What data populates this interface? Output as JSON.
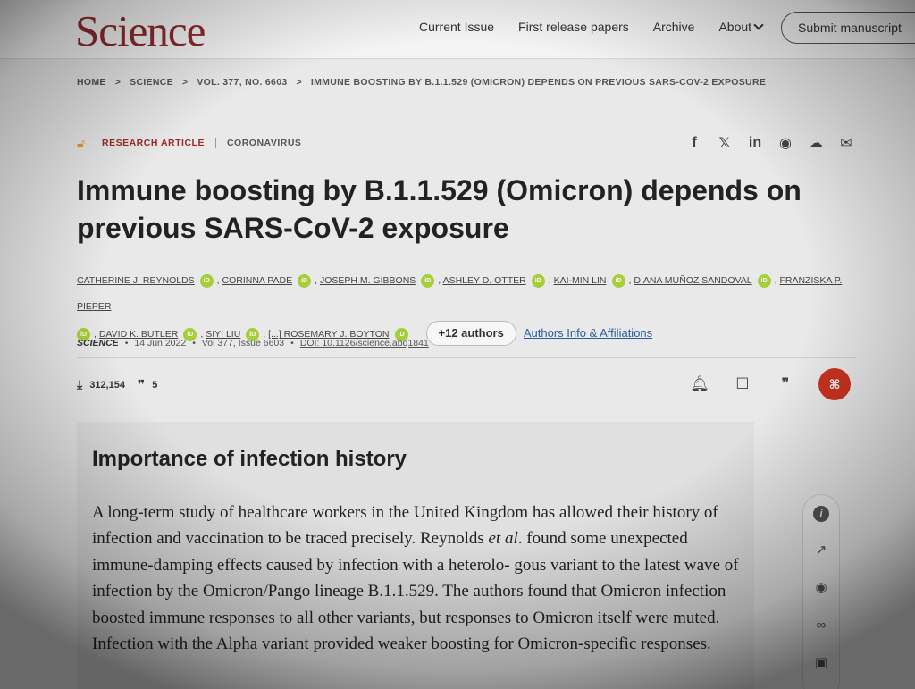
{
  "header": {
    "logo": "Science",
    "nav": [
      "Current Issue",
      "First release papers",
      "Archive",
      "About"
    ],
    "submit_label": "Submit manuscript"
  },
  "breadcrumb": [
    "HOME",
    "SCIENCE",
    "VOL. 377, NO. 6603",
    "IMMUNE BOOSTING BY B.1.1.529 (OMICRON) DEPENDS ON PREVIOUS SARS-COV-2 EXPOSURE"
  ],
  "article": {
    "type": "RESEARCH ARTICLE",
    "subject": "CORONAVIRUS",
    "title": "Immune boosting by B.1.1.529 (Omicron) depends on previous SARS-CoV-2 exposure",
    "authors": [
      "CATHERINE J. REYNOLDS",
      "CORINNA PADE",
      "JOSEPH M. GIBBONS",
      "ASHLEY D. OTTER",
      "KAI-MIN LIN",
      "DIANA MUÑOZ SANDOVAL",
      "FRANZISKA P. PIEPER",
      "DAVID K. BUTLER",
      "SIYI LIU",
      "[...] ROSEMARY J. BOYTON"
    ],
    "more_authors": "+12 authors",
    "affiliations_link": "Authors Info & Affiliations",
    "journal": "SCIENCE",
    "date": "14 Jun 2022",
    "volume": "Vol 377, Issue 6603",
    "doi": "DOI: 10.1126/science.abq1841",
    "downloads": "312,154",
    "citations": "5"
  },
  "summary": {
    "heading": "Importance of infection history",
    "body_1": "A long-term study of healthcare workers in the United Kingdom has allowed their history of infection and vaccination to be traced precisely. Reynolds ",
    "body_em": "et al",
    "body_2": ". found some unexpected immune-damping effects caused by infection with a heterolo- gous variant to the latest wave of infection by the Omicron/Pango lineage B.1.1.529. The authors found that Omicron infection boosted immune responses to all other variants, but responses to Omicron itself were muted. Infection with the Alpha variant provided weaker boosting for Omicron-specific responses."
  },
  "icons": {
    "share": [
      "facebook-icon",
      "twitter-icon",
      "linkedin-icon",
      "reddit-icon",
      "wechat-icon",
      "email-icon"
    ],
    "actions": [
      "bell-icon",
      "bookmark-icon",
      "quote-icon",
      "pdf-icon"
    ],
    "side": [
      "info-icon",
      "trending-icon",
      "eye-icon",
      "link-icon",
      "image-icon"
    ]
  },
  "colors": {
    "brand": "#8e2b2b",
    "orcid": "#a6ce39",
    "pdf": "#c9321f",
    "link": "#2a5d9f"
  }
}
